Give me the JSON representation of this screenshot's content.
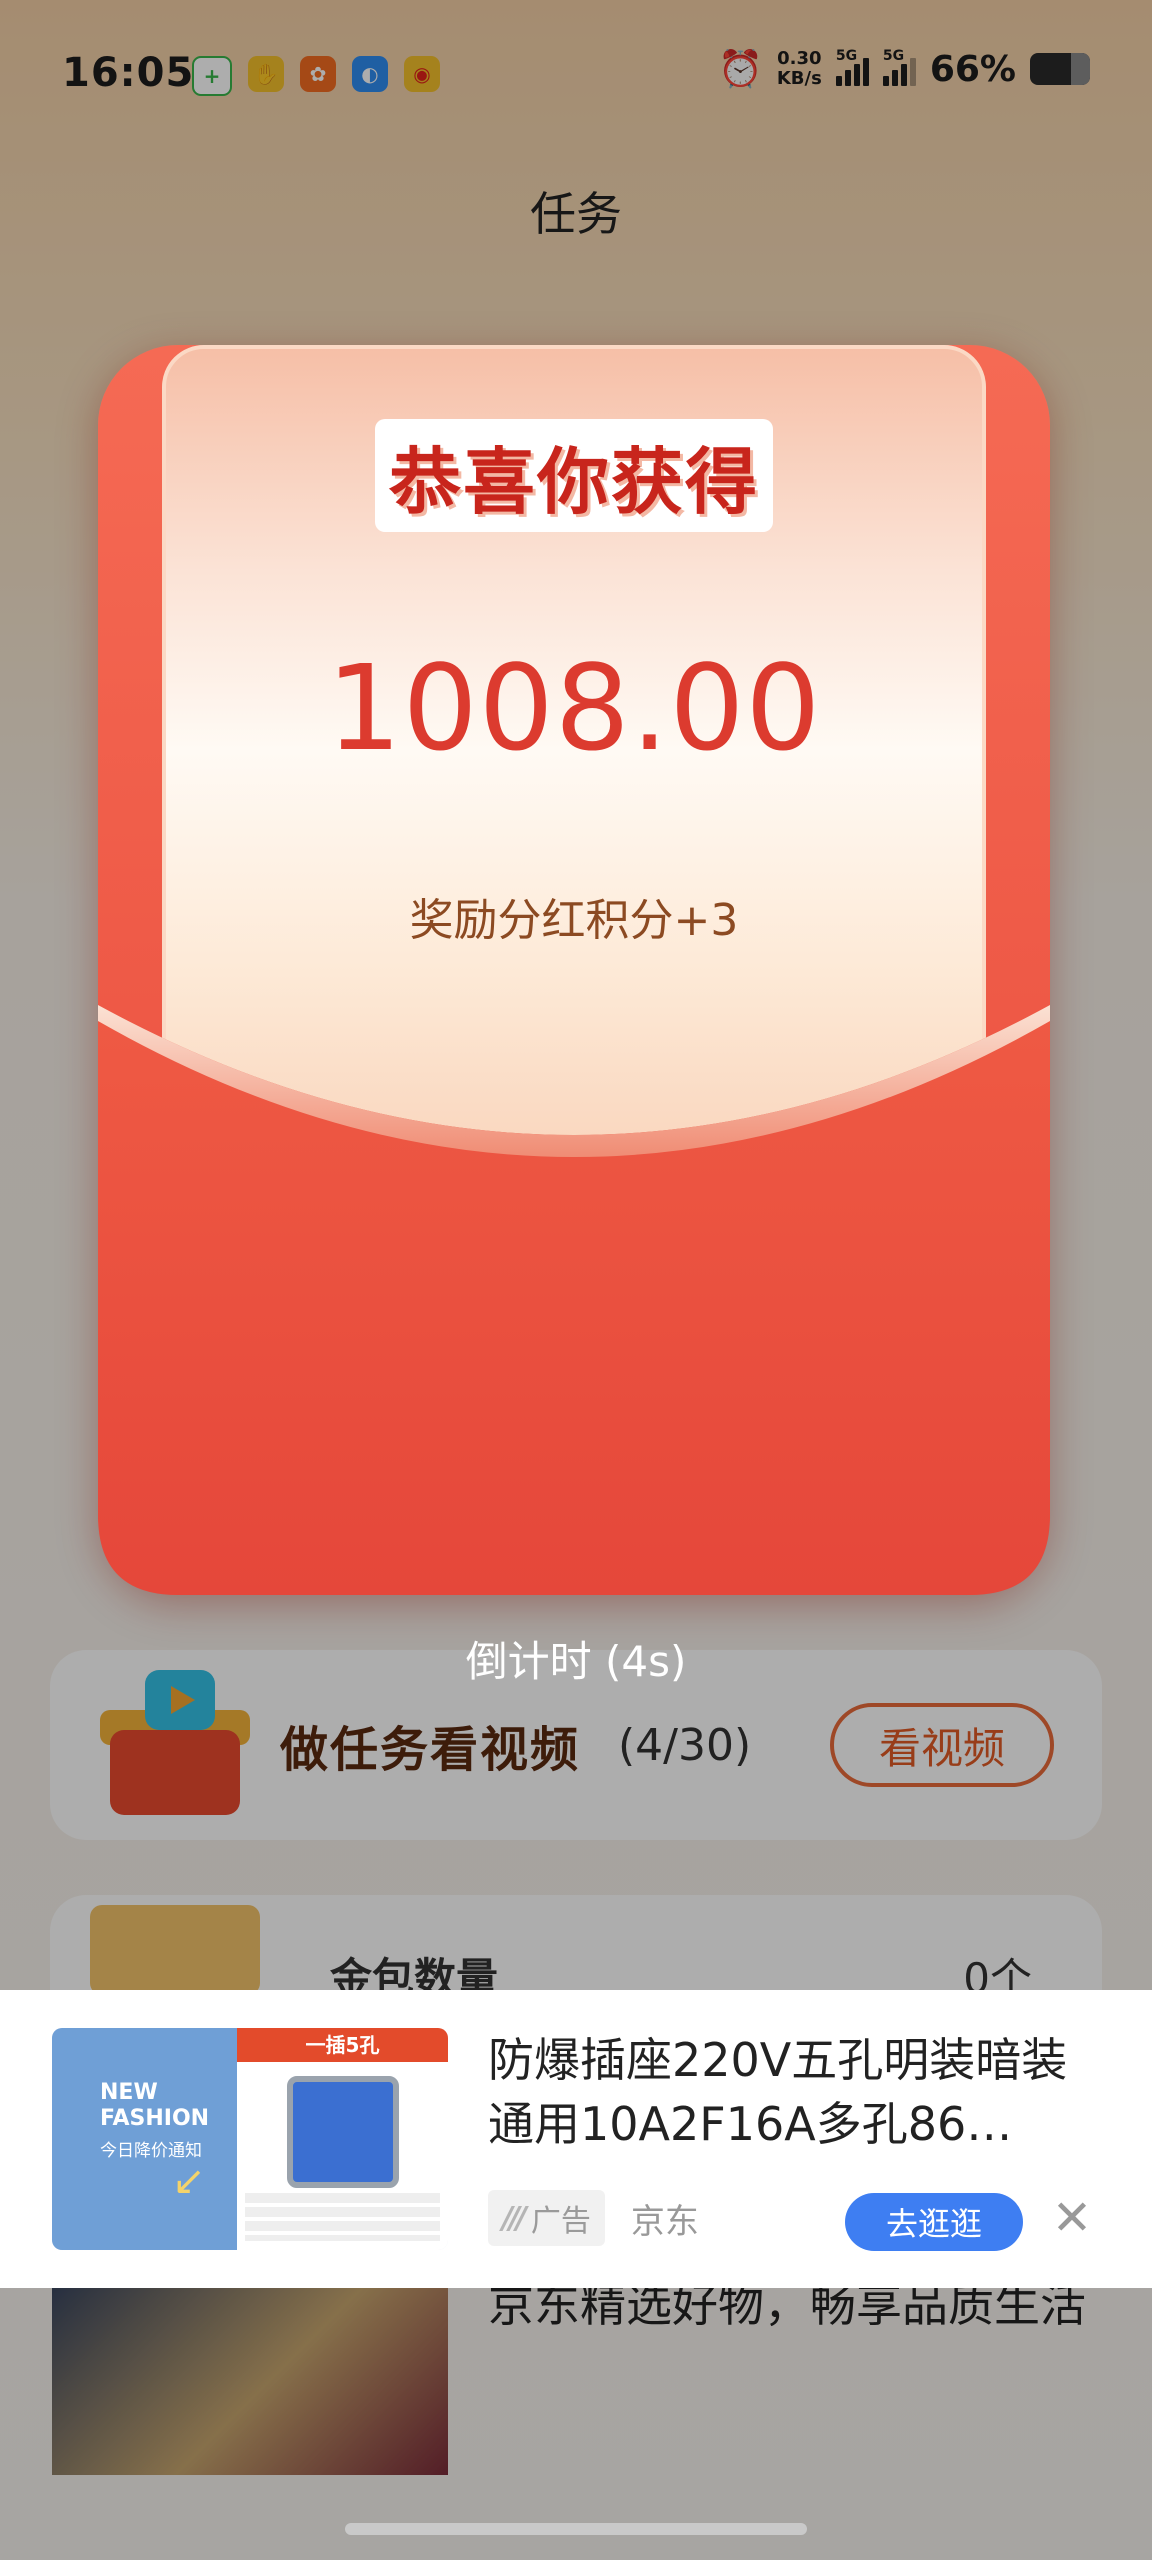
{
  "status_bar": {
    "time": "16:05",
    "net_speed_value": "0.30",
    "net_speed_unit": "KB/s",
    "signal1_label": "5G",
    "signal2_label": "5G",
    "battery": "66%"
  },
  "page": {
    "title": "任务"
  },
  "background": {
    "task_title": "做任务看视频",
    "task_count": "(4/30)",
    "task_button": "看视频",
    "gold_label": "金包数量",
    "gold_value": "0个",
    "ad2_title": "京东精选好物，畅享品质生活"
  },
  "modal": {
    "congrats": "恭喜你获得",
    "amount": "1008.00",
    "reward": "奖励分红积分+3",
    "countdown": "倒计时 (4s)"
  },
  "ad": {
    "thumb_fashion": "NEW FASHION",
    "thumb_deal": "今日降价通知",
    "thumb_header": "一插5孔",
    "title": "防爆插座220V五孔明装暗装通用10A2F16A多孔86…",
    "tag": "广告",
    "source": "京东",
    "button": "去逛逛",
    "close_icon": "close-icon"
  },
  "colors": {
    "accent_red": "#e84a3a",
    "amount_red": "#dc3b2f",
    "button_blue": "#3e7ef2"
  }
}
